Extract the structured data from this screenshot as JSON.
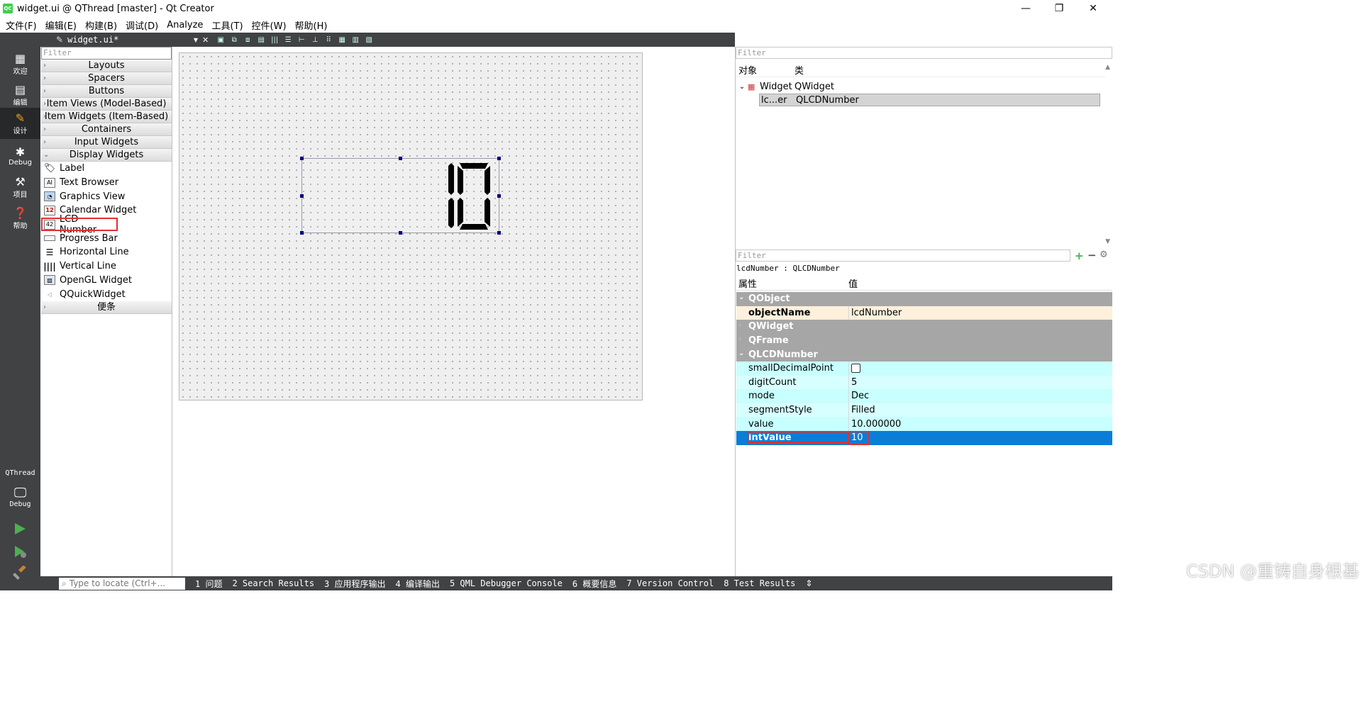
{
  "window": {
    "title": "widget.ui @ QThread [master] - Qt Creator",
    "app_icon": "QC",
    "minimize": "—",
    "restore": "❐",
    "close": "✕"
  },
  "menu": [
    "文件(F)",
    "编辑(E)",
    "构建(B)",
    "调试(D)",
    "Analyze",
    "工具(T)",
    "控件(W)",
    "帮助(H)"
  ],
  "modes": [
    {
      "label": "欢迎",
      "icon": "grid-icon"
    },
    {
      "label": "编辑",
      "icon": "edit-doc-icon"
    },
    {
      "label": "设计",
      "icon": "pencil-icon"
    },
    {
      "label": "Debug",
      "icon": "bug-icon"
    },
    {
      "label": "项目",
      "icon": "wrench-icon"
    },
    {
      "label": "帮助",
      "icon": "help-icon"
    }
  ],
  "kit": {
    "project": "QThread",
    "config": "Debug"
  },
  "editor": {
    "doc_name": "widget.ui*"
  },
  "widget_box": {
    "filter_placeholder": "Filter",
    "categories_top": [
      "Layouts",
      "Spacers",
      "Buttons",
      "Item Views (Model-Based)",
      "Item Widgets (Item-Based)",
      "Containers",
      "Input Widgets"
    ],
    "open_category": "Display Widgets",
    "items": [
      {
        "label": "Label",
        "icon": "label-tag-icon"
      },
      {
        "label": "Text Browser",
        "icon": "text-browser-icon"
      },
      {
        "label": "Graphics View",
        "icon": "graphics-view-icon"
      },
      {
        "label": "Calendar Widget",
        "icon": "calendar-icon"
      },
      {
        "label": "LCD Number",
        "icon": "lcd-number-icon"
      },
      {
        "label": "Progress Bar",
        "icon": "progress-bar-icon"
      },
      {
        "label": "Horizontal Line",
        "icon": "horizontal-line-icon"
      },
      {
        "label": "Vertical Line",
        "icon": "vertical-line-icon"
      },
      {
        "label": "OpenGL Widget",
        "icon": "opengl-icon"
      },
      {
        "label": "QQuickWidget",
        "icon": "qquick-icon"
      }
    ],
    "bottom_category": "便条"
  },
  "form": {
    "lcd_display": "10"
  },
  "object_inspector": {
    "filter_placeholder": "Filter",
    "col_object": "对象",
    "col_class": "类",
    "rows": [
      {
        "object": "Widget",
        "class": "QWidget"
      },
      {
        "object": "lc...er",
        "class": "QLCDNumber"
      }
    ]
  },
  "property_editor": {
    "filter_placeholder": "Filter",
    "subtitle": "lcdNumber : QLCDNumber",
    "col_property": "属性",
    "col_value": "值",
    "groups": {
      "qobject": "QObject",
      "qwidget": "QWidget",
      "qframe": "QFrame",
      "qlcdnumber": "QLCDNumber"
    },
    "objectName": {
      "name": "objectName",
      "value": "lcdNumber"
    },
    "props": [
      {
        "name": "smallDecimalPoint",
        "value": ""
      },
      {
        "name": "digitCount",
        "value": "5"
      },
      {
        "name": "mode",
        "value": "Dec"
      },
      {
        "name": "segmentStyle",
        "value": "Filled"
      },
      {
        "name": "value",
        "value": "10.000000"
      },
      {
        "name": "intValue",
        "value": "10"
      }
    ]
  },
  "statusbar": {
    "locator_placeholder": "Type to locate (Ctrl+...",
    "tabs": [
      "1 问题",
      "2 Search Results",
      "3 应用程序输出",
      "4 编译输出",
      "5 QML Debugger Console",
      "6 概要信息",
      "7 Version Control",
      "8 Test Results"
    ]
  },
  "watermark": "CSDN @重铸自身根基"
}
